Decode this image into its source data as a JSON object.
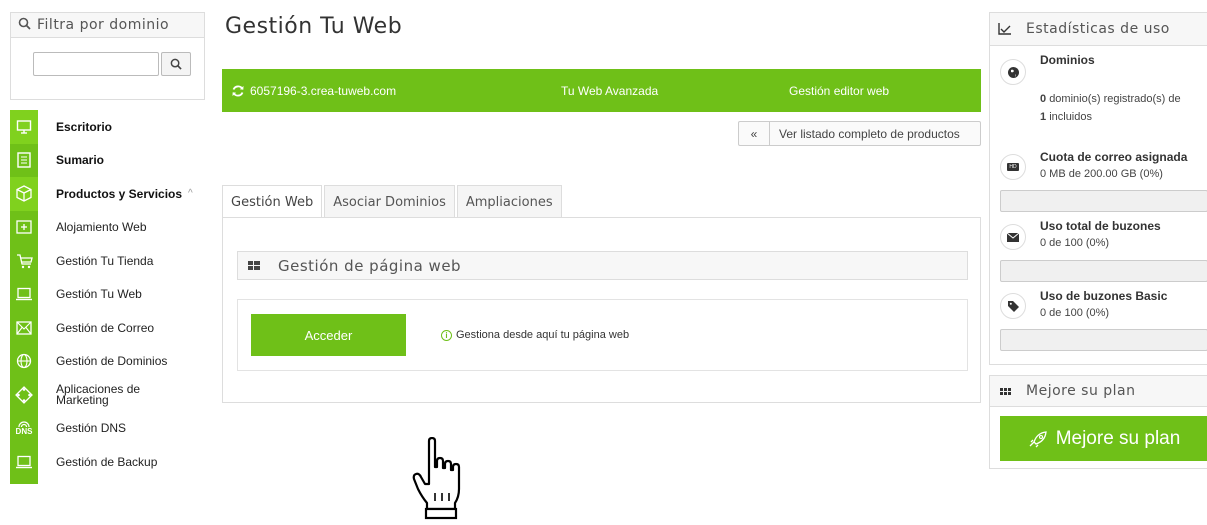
{
  "sidebar": {
    "filter_title": "Filtra por dominio",
    "filter_input_value": "",
    "items": [
      {
        "label": "Escritorio",
        "icon": "monitor-icon",
        "bold": true
      },
      {
        "label": "Sumario",
        "icon": "list-icon",
        "bold": true
      },
      {
        "label": "Productos y Servicios",
        "icon": "cube-icon",
        "bold": true,
        "caret": "^"
      },
      {
        "label": "Alojamiento Web",
        "icon": "plus-box-icon"
      },
      {
        "label": "Gestión Tu Tienda",
        "icon": "cart-icon"
      },
      {
        "label": "Gestión Tu Web",
        "icon": "laptop-icon"
      },
      {
        "label": "Gestión de Correo",
        "icon": "mail-icon"
      },
      {
        "label": "Gestión de Dominios",
        "icon": "globe-icon"
      },
      {
        "label": "Aplicaciones de Marketing",
        "icon": "marketing-icon"
      },
      {
        "label": "Gestión DNS",
        "icon": "dns-icon",
        "icon_text": "DNS"
      },
      {
        "label": "Gestión de Backup",
        "icon": "laptop-icon"
      }
    ]
  },
  "main": {
    "title": "Gestión Tu Web",
    "product_bar": {
      "domain": "6057196-3.crea-tuweb.com",
      "plan": "Tu Web Avanzada",
      "editor": "Gestión editor web"
    },
    "list_button": {
      "arrow": "«",
      "label": "Ver listado completo de productos"
    },
    "tabs": [
      "Gestión Web",
      "Asociar Dominios",
      "Ampliaciones"
    ],
    "section_title": "Gestión de página web",
    "access_button": "Acceder",
    "access_info": "Gestiona desde aquí tu página web"
  },
  "stats": {
    "title": "Estadísticas de uso",
    "domains": {
      "title": "Dominios",
      "registered_count": "0",
      "registered_text": "dominio(s) registrado(s) de",
      "included_count": "1",
      "included_text": "incluidos"
    },
    "mail_quota": {
      "title": "Cuota de correo asignada",
      "value": "0 MB de 200.00 GB (0%)",
      "percent": 0
    },
    "mailboxes": {
      "title": "Uso total de buzones",
      "value": "0 de 100 (0%)",
      "percent": 0
    },
    "basic_mailboxes": {
      "title": "Uso de buzones Basic",
      "value": "0 de 100 (0%)",
      "percent": 0
    }
  },
  "improve": {
    "title": "Mejore su plan",
    "button": "Mejore su plan"
  },
  "colors": {
    "accent": "#6fc018",
    "active_icon": "#80d11e"
  }
}
